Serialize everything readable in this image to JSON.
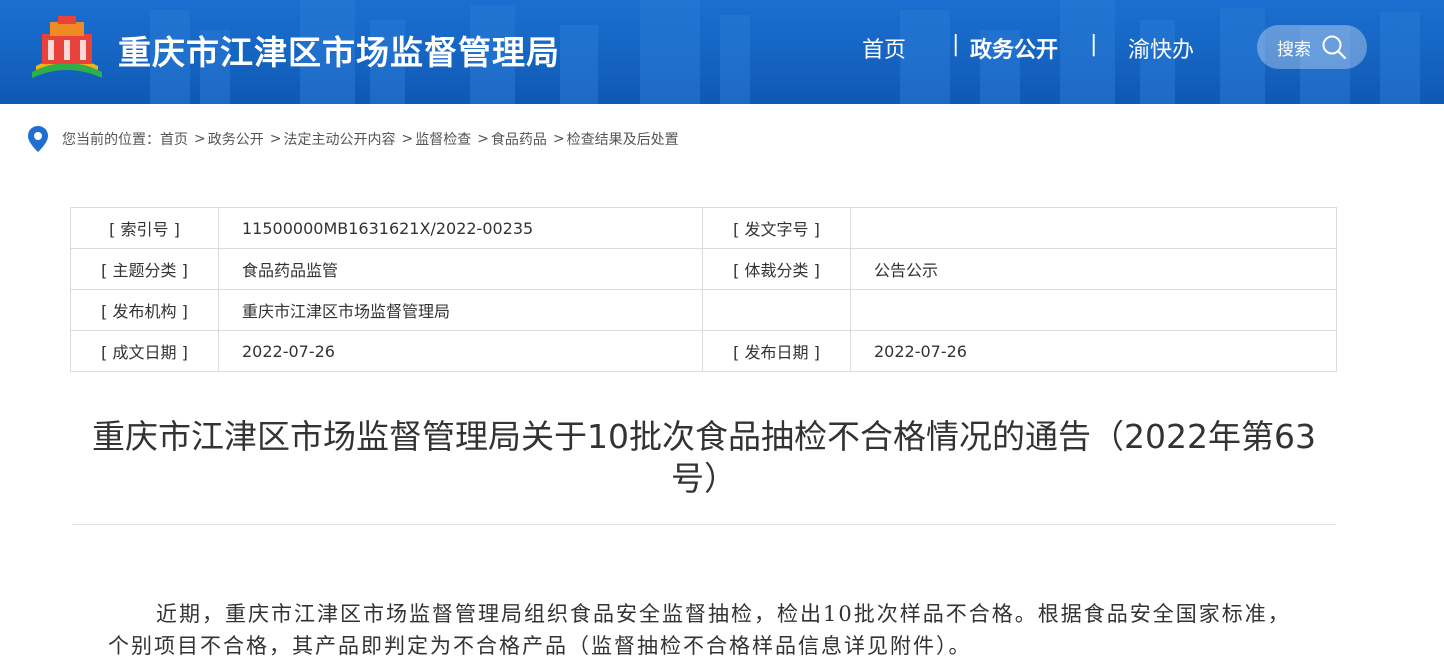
{
  "header": {
    "site_title": "重庆市江津区市场监督管理局",
    "nav": {
      "home": "首页",
      "gov_affairs": "政务公开",
      "quick": "渝快办",
      "separator": "|"
    },
    "search_label": "搜索",
    "colors": {
      "bg": "#1564c2",
      "text": "#ffffff"
    }
  },
  "breadcrumb": {
    "prefix": "您当前的位置：",
    "items": [
      "首页",
      "政务公开",
      "法定主动公开内容",
      "监督检查",
      "食品药品",
      "检查结果及后处置"
    ],
    "separator": ">"
  },
  "meta": {
    "rows": [
      {
        "label1": "[ 索引号 ]",
        "value1": "11500000MB1631621X/2022-00235",
        "label2": "[ 发文字号 ]",
        "value2": ""
      },
      {
        "label1": "[ 主题分类 ]",
        "value1": "食品药品监管",
        "label2": "[ 体裁分类 ]",
        "value2": "公告公示"
      },
      {
        "label1": "[ 发布机构 ]",
        "value1": "重庆市江津区市场监督管理局",
        "label2": "",
        "value2": ""
      },
      {
        "label1": "[ 成文日期 ]",
        "value1": "2022-07-26",
        "label2": "[ 发布日期 ]",
        "value2": "2022-07-26"
      }
    ]
  },
  "article": {
    "title": "重庆市江津区市场监督管理局关于10批次食品抽检不合格情况的通告（2022年第63号）",
    "paragraph": "近期，重庆市江津区市场监督管理局组织食品安全监督抽检，检出10批次样品不合格。根据食品安全国家标准，个别项目不合格，其产品即判定为不合格产品（监督抽检不合格样品信息详见附件）。"
  }
}
